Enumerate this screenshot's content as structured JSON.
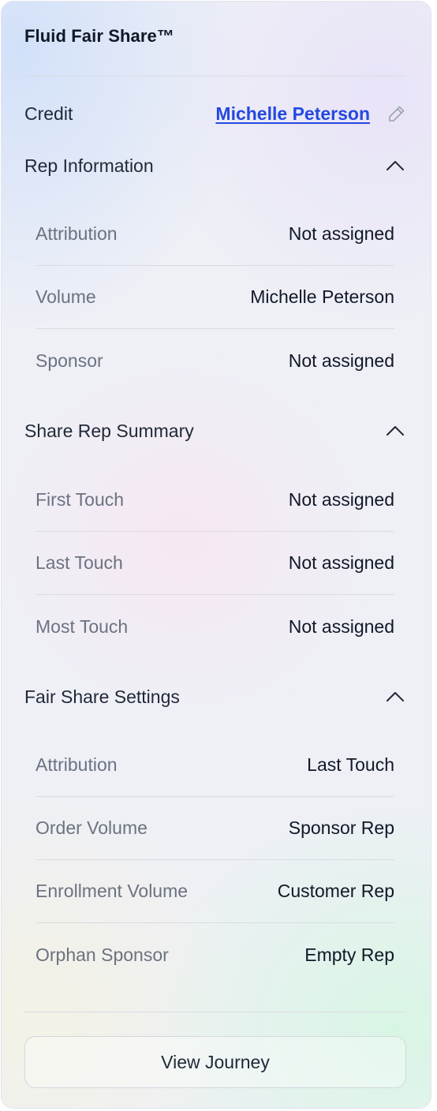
{
  "panel": {
    "title": "Fluid Fair Share™"
  },
  "credit": {
    "label": "Credit",
    "value": "Michelle Peterson",
    "edit_icon": "pencil-icon"
  },
  "sections": [
    {
      "title": "Rep Information",
      "expanded": true,
      "rows": [
        {
          "label": "Attribution",
          "value": "Not assigned"
        },
        {
          "label": "Volume",
          "value": "Michelle Peterson"
        },
        {
          "label": "Sponsor",
          "value": "Not assigned"
        }
      ]
    },
    {
      "title": "Share Rep Summary",
      "expanded": true,
      "rows": [
        {
          "label": "First Touch",
          "value": "Not assigned"
        },
        {
          "label": "Last Touch",
          "value": "Not assigned"
        },
        {
          "label": "Most Touch",
          "value": "Not assigned"
        }
      ]
    },
    {
      "title": "Fair Share Settings",
      "expanded": true,
      "rows": [
        {
          "label": "Attribution",
          "value": "Last Touch"
        },
        {
          "label": "Order Volume",
          "value": "Sponsor Rep"
        },
        {
          "label": "Enrollment Volume",
          "value": "Customer Rep"
        },
        {
          "label": "Orphan Sponsor",
          "value": "Empty Rep"
        }
      ]
    }
  ],
  "actions": {
    "view_journey_label": "View Journey"
  },
  "colors": {
    "link": "#2448e0",
    "text_primary": "#111827",
    "text_secondary": "#6b7280",
    "divider": "#d9dbe3"
  }
}
